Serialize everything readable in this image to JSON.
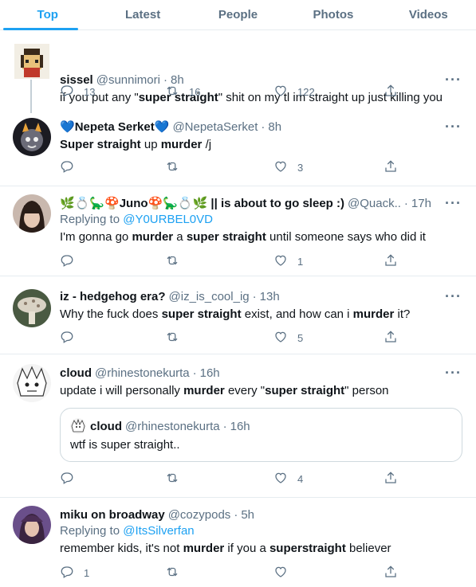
{
  "tabs": [
    "Top",
    "Latest",
    "People",
    "Photos",
    "Videos"
  ],
  "tweets": [
    {
      "name": "sissel",
      "handle": "@sunnimori",
      "time": "8h",
      "segments": [
        {
          "t": "if you put any \""
        },
        {
          "t": "super straight",
          "b": true
        },
        {
          "t": "\" shit on my tl im straight up just killing you"
        }
      ],
      "replies": "13",
      "retweets": "16",
      "likes": "122"
    },
    {
      "name_emoji_left": "💙",
      "name": "Nepeta Serket",
      "name_emoji_right": "💙",
      "handle": "@NepetaSerket",
      "time": "8h",
      "segments": [
        {
          "t": "Super straight",
          "b": true
        },
        {
          "t": " up "
        },
        {
          "t": "murder",
          "b": true
        },
        {
          "t": " /j"
        }
      ],
      "replies": "",
      "retweets": "",
      "likes": "3"
    },
    {
      "name": "🌿💍🦕🍄Juno🍄🦕💍🌿 || is about to go sleep :)",
      "handle": "@Quack..",
      "time": "17h",
      "reply_prefix": "Replying to ",
      "reply_to": "@Y0URBEL0VD",
      "segments": [
        {
          "t": "I'm gonna go "
        },
        {
          "t": "murder",
          "b": true
        },
        {
          "t": " a "
        },
        {
          "t": "super straight",
          "b": true
        },
        {
          "t": " until someone says who did it"
        }
      ],
      "replies": "",
      "retweets": "",
      "likes": "1"
    },
    {
      "name": "iz - hedgehog era?",
      "handle": "@iz_is_cool_ig",
      "time": "13h",
      "segments": [
        {
          "t": "Why the fuck does "
        },
        {
          "t": "super straight",
          "b": true
        },
        {
          "t": " exist, and how can i "
        },
        {
          "t": "murder",
          "b": true
        },
        {
          "t": " it?"
        }
      ],
      "replies": "",
      "retweets": "",
      "likes": "5"
    },
    {
      "name": "cloud",
      "handle": "@rhinestonekurta",
      "time": "16h",
      "segments": [
        {
          "t": "update i will personally "
        },
        {
          "t": "murder",
          "b": true
        },
        {
          "t": " every \""
        },
        {
          "t": "super straight",
          "b": true
        },
        {
          "t": "\" person"
        }
      ],
      "quote": {
        "name": "cloud",
        "handle": "@rhinestonekurta",
        "time": "16h",
        "text": "wtf is super straight.."
      },
      "replies": "",
      "retweets": "",
      "likes": "4"
    },
    {
      "name": "miku on broadway",
      "handle": "@cozypods",
      "time": "5h",
      "reply_prefix": "Replying to ",
      "reply_to": "@ItsSilverfan",
      "segments": [
        {
          "t": "remember kids, it's not "
        },
        {
          "t": "murder",
          "b": true
        },
        {
          "t": " if you a "
        },
        {
          "t": "superstraight",
          "b": true
        },
        {
          "t": " believer"
        }
      ],
      "replies": "1",
      "retweets": "",
      "likes": ""
    }
  ],
  "dot": "·",
  "more": "···",
  "colors": {
    "accent": "#1da1f2",
    "muted": "#5b7083",
    "border": "#e6ecf0"
  },
  "icons": [
    "reply-icon",
    "retweet-icon",
    "like-icon",
    "share-icon",
    "more-icon"
  ]
}
